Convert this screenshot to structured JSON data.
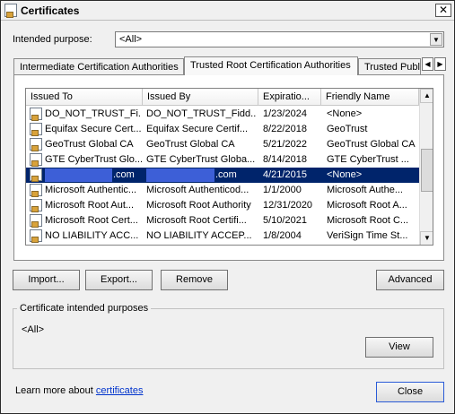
{
  "window": {
    "title": "Certificates",
    "close_glyph": "✕"
  },
  "purpose": {
    "label": "Intended purpose:",
    "value": "<All>",
    "arrow": "▼"
  },
  "tabs": [
    {
      "label": "Intermediate Certification Authorities"
    },
    {
      "label": "Trusted Root Certification Authorities"
    },
    {
      "label": "Trusted Publ"
    }
  ],
  "tab_scroll": {
    "left": "◀",
    "right": "▶"
  },
  "columns": [
    "Issued To",
    "Issued By",
    "Expiratio...",
    "Friendly Name"
  ],
  "rows": [
    {
      "issued_to": "DO_NOT_TRUST_Fi...",
      "issued_by": "DO_NOT_TRUST_Fidd...",
      "expiration": "1/23/2024",
      "friendly": "<None>"
    },
    {
      "issued_to": "Equifax Secure Cert...",
      "issued_by": "Equifax Secure Certif...",
      "expiration": "8/22/2018",
      "friendly": "GeoTrust"
    },
    {
      "issued_to": "GeoTrust Global CA",
      "issued_by": "GeoTrust Global CA",
      "expiration": "5/21/2022",
      "friendly": "GeoTrust Global CA"
    },
    {
      "issued_to": "GTE CyberTrust Glo...",
      "issued_by": "GTE CyberTrust Globa...",
      "expiration": "8/14/2018",
      "friendly": "GTE CyberTrust ..."
    },
    {
      "issued_to": ".com",
      "issued_by": ".com",
      "expiration": "4/21/2015",
      "friendly": "<None>",
      "selected": true
    },
    {
      "issued_to": "Microsoft Authentic...",
      "issued_by": "Microsoft Authenticod...",
      "expiration": "1/1/2000",
      "friendly": "Microsoft Authe..."
    },
    {
      "issued_to": "Microsoft Root Aut...",
      "issued_by": "Microsoft Root Authority",
      "expiration": "12/31/2020",
      "friendly": "Microsoft Root A..."
    },
    {
      "issued_to": "Microsoft Root Cert...",
      "issued_by": "Microsoft Root Certifi...",
      "expiration": "5/10/2021",
      "friendly": "Microsoft Root C..."
    },
    {
      "issued_to": "NO LIABILITY ACC...",
      "issued_by": "NO LIABILITY ACCEP...",
      "expiration": "1/8/2004",
      "friendly": "VeriSign Time St..."
    }
  ],
  "list_scroll": {
    "up": "▲",
    "down": "▼"
  },
  "buttons": {
    "import": "Import...",
    "export": "Export...",
    "remove": "Remove",
    "advanced": "Advanced",
    "view": "View",
    "close": "Close"
  },
  "purposes_group": {
    "label": "Certificate intended purposes",
    "value": "<All>"
  },
  "learn": {
    "prefix": "Learn more about ",
    "link": "certificates"
  },
  "colors": {
    "selection": "#00246b",
    "redaction": "#3d5fd7",
    "link": "#0033cc"
  }
}
